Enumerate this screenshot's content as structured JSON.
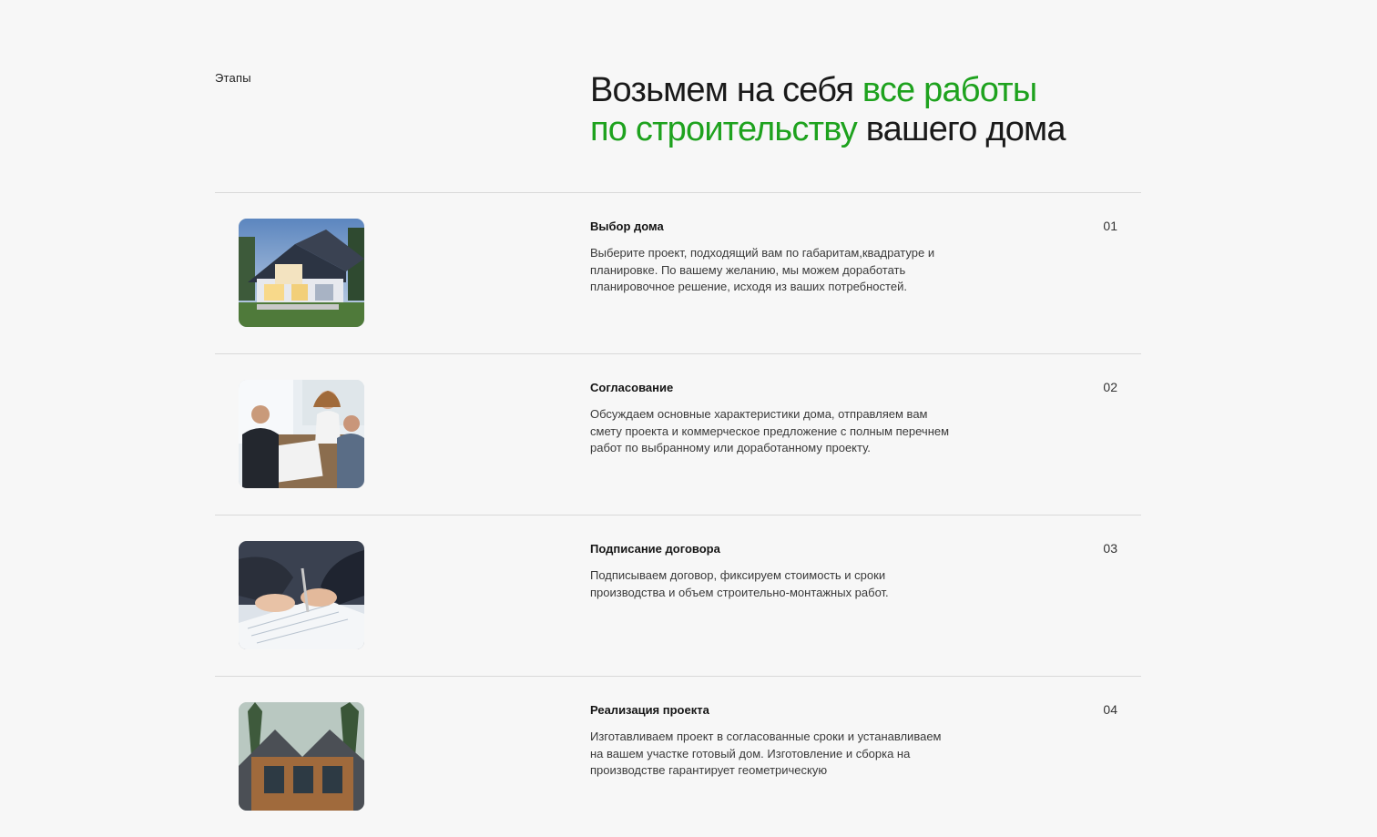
{
  "theme": {
    "accent": "#1ea21e",
    "background": "#f7f7f7"
  },
  "section": {
    "label": "Этапы"
  },
  "heading": {
    "part1": "Возьмем на себя ",
    "accent1": "все работы",
    "accent2": "по строительству",
    "part2": " вашего дома"
  },
  "steps": [
    {
      "title": "Выбор дома",
      "number": "01",
      "description": "Выберите проект, подходящий вам по габаритам,квадратуре и планировке. По вашему желанию, мы можем доработать планировочное решение, исходя из ваших потребностей.",
      "image_icon": "house-photo"
    },
    {
      "title": "Согласование",
      "number": "02",
      "description": "Обсуждаем основные характеристики дома, отправляем вам смету проекта и коммерческое предложение с полным перечнем работ по выбранному или доработанному проекту.",
      "image_icon": "meeting-photo"
    },
    {
      "title": "Подписание договора",
      "number": "03",
      "description": "Подписываем договор, фиксируем стоимость и сроки производства и объем строительно-монтажных работ.",
      "image_icon": "contract-signing-photo"
    },
    {
      "title": "Реализация проекта",
      "number": "04",
      "description": "Изготавливаем проект в согласованные сроки и устанавливаем на вашем участке готовый дом. Изготовление и сборка на производстве гарантирует геометрическую",
      "image_icon": "wooden-house-photo"
    }
  ]
}
